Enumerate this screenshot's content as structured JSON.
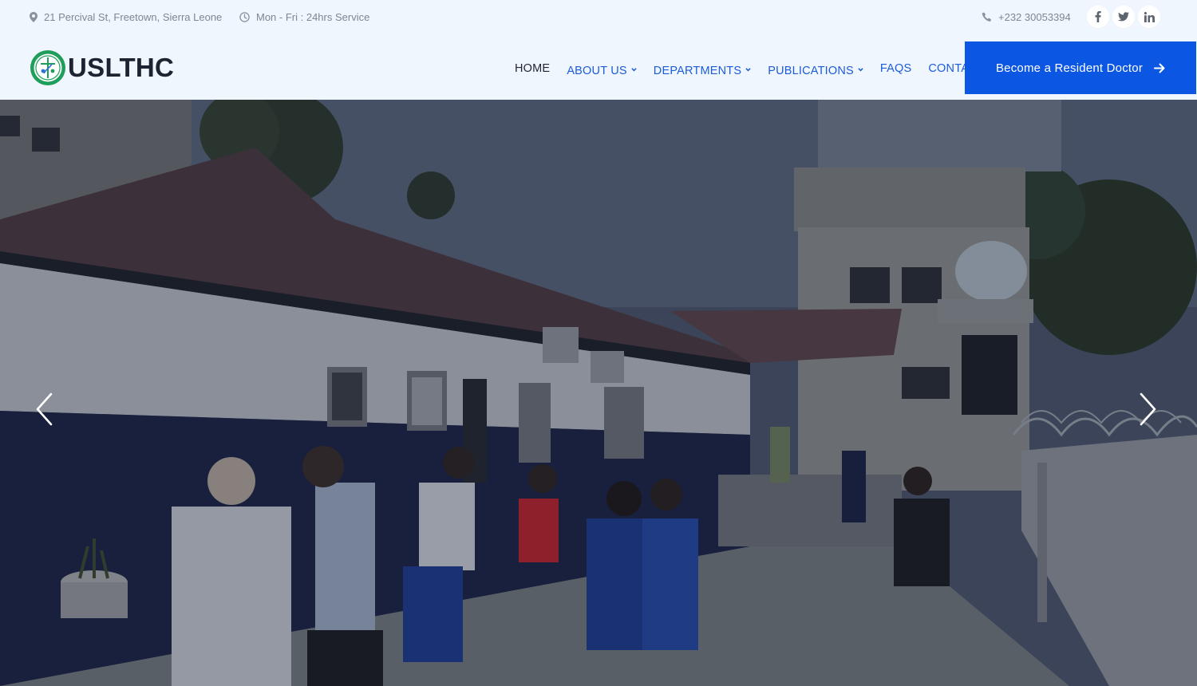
{
  "topbar": {
    "address": "21 Percival St, Freetown, Sierra Leone",
    "hours": "Mon - Fri : 24hrs Service",
    "phone": "+232 30053394",
    "social": [
      {
        "icon": "facebook-icon",
        "glyph": "f"
      },
      {
        "icon": "twitter-icon",
        "glyph": "t"
      },
      {
        "icon": "linkedin-icon",
        "glyph": "in"
      }
    ]
  },
  "brand": {
    "name": "USLTHC",
    "accent_color": "#0b56e3",
    "logo_green": "#1e9e5a"
  },
  "nav": {
    "items": [
      {
        "label": "HOME",
        "active": true,
        "dropdown": false
      },
      {
        "label": "ABOUT US",
        "active": false,
        "dropdown": true
      },
      {
        "label": "DEPARTMENTS",
        "active": false,
        "dropdown": true
      },
      {
        "label": "PUBLICATIONS",
        "active": false,
        "dropdown": true
      },
      {
        "label": "FAQS",
        "active": false,
        "dropdown": false
      },
      {
        "label": "CONTACT",
        "active": false,
        "dropdown": false
      }
    ],
    "cta_label": "Become a Resident Doctor"
  },
  "hero": {
    "image": "hospital-courtyard-photo",
    "prev_icon": "chevron-left-icon",
    "next_icon": "chevron-right-icon"
  }
}
